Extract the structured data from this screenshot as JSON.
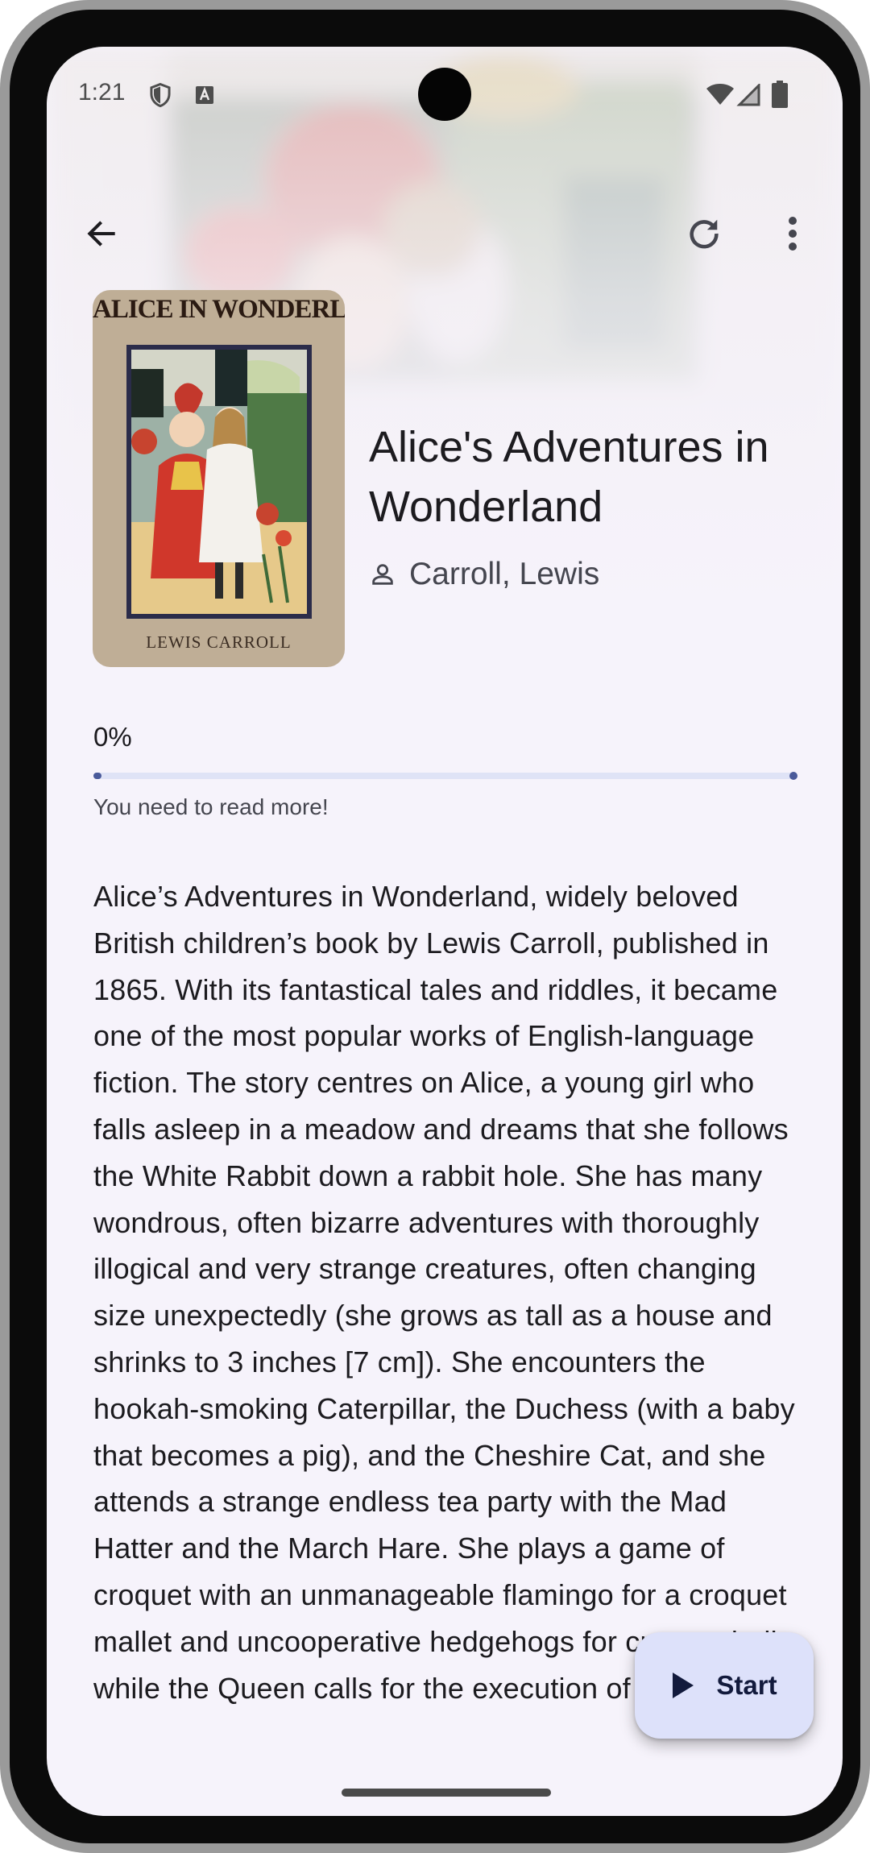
{
  "status_bar": {
    "time": "1:21",
    "left_icons": [
      "shield-icon",
      "keyboard-a-icon"
    ],
    "right_icons": [
      "wifi-icon",
      "cell-signal-icon",
      "battery-icon"
    ]
  },
  "top_bar": {
    "back_icon": "arrow-back-icon",
    "refresh_icon": "refresh-icon",
    "menu_icon": "more-vert-icon"
  },
  "book": {
    "cover_title": "ALICE IN WONDERLAND",
    "cover_author": "LEWIS CARROLL",
    "title": "Alice's Adventures in Wonderland",
    "author": "Carroll, Lewis",
    "author_icon": "person-icon"
  },
  "progress": {
    "percent_label": "0%",
    "value": 0,
    "message": "You need to read more!"
  },
  "description": "Alice’s Adventures in Wonderland, widely beloved British children’s book by Lewis Carroll, published in 1865. With its fantastical tales and riddles, it became one of the most popular works of English-language fiction. The story centres on Alice, a young girl who falls asleep in a meadow and dreams that she follows the White Rabbit down a rabbit hole. She has many wondrous, often bizarre adventures with thoroughly illogical and very strange creatures, often changing size unexpectedly (she grows as tall as a house and shrinks to 3 inches [7 cm]). She encounters the hookah-smoking Caterpillar, the Duchess (with a baby that becomes a pig), and the Cheshire Cat, and she attends a strange endless tea party with the Mad Hatter and the March Hare. She plays a game of croquet with an unmanageable flamingo for a croquet mallet and uncooperative hedgehogs for croquet balls while the Queen calls for the execution of",
  "fab": {
    "label": "Start",
    "icon": "play-icon"
  },
  "colors": {
    "background": "#f6f3fb",
    "accent": "#4a5a9a",
    "fab_background": "#dde1fa",
    "text_primary": "#1c1b1f",
    "text_secondary": "#45464f"
  }
}
